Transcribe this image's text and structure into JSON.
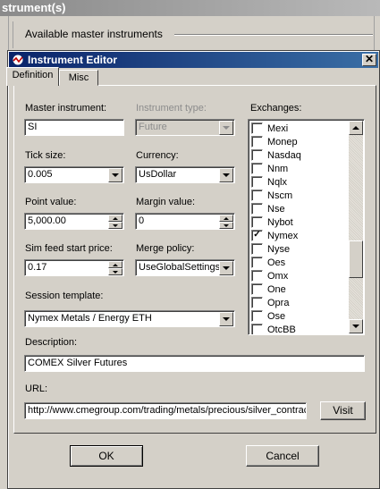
{
  "background_window": {
    "title": "strument(s)",
    "available_label": "Available master instruments"
  },
  "dialog": {
    "title": "Instrument Editor",
    "close_glyph": "✕",
    "tabs": [
      {
        "label": "Definition",
        "active": true
      },
      {
        "label": "Misc",
        "active": false
      }
    ]
  },
  "form": {
    "master_instrument": {
      "label": "Master instrument:",
      "value": "SI"
    },
    "instrument_type": {
      "label": "Instrument type:",
      "value": "Future",
      "enabled": false
    },
    "tick_size": {
      "label": "Tick size:",
      "value": "0.005"
    },
    "currency": {
      "label": "Currency:",
      "value": "UsDollar"
    },
    "point_value": {
      "label": "Point value:",
      "value": "5,000.00"
    },
    "margin_value": {
      "label": "Margin value:",
      "value": "0"
    },
    "sim_feed_start_price": {
      "label": "Sim feed start price:",
      "value": "0.17"
    },
    "merge_policy": {
      "label": "Merge policy:",
      "value": "UseGlobalSettings"
    },
    "session_template": {
      "label": "Session template:",
      "value": "Nymex Metals / Energy ETH"
    },
    "description": {
      "label": "Description:",
      "value": "COMEX Silver Futures"
    },
    "url": {
      "label": "URL:",
      "value": "http://www.cmegroup.com/trading/metals/precious/silver_contract"
    }
  },
  "exchanges": {
    "label": "Exchanges:",
    "items": [
      {
        "name": "Mexi",
        "checked": false
      },
      {
        "name": "Monep",
        "checked": false
      },
      {
        "name": "Nasdaq",
        "checked": false
      },
      {
        "name": "Nnm",
        "checked": false
      },
      {
        "name": "Nqlx",
        "checked": false
      },
      {
        "name": "Nscm",
        "checked": false
      },
      {
        "name": "Nse",
        "checked": false
      },
      {
        "name": "Nybot",
        "checked": false
      },
      {
        "name": "Nymex",
        "checked": true
      },
      {
        "name": "Nyse",
        "checked": false
      },
      {
        "name": "Oes",
        "checked": false
      },
      {
        "name": "Omx",
        "checked": false
      },
      {
        "name": "One",
        "checked": false
      },
      {
        "name": "Opra",
        "checked": false
      },
      {
        "name": "Ose",
        "checked": false
      },
      {
        "name": "OtcBB",
        "checked": false
      }
    ],
    "check_glyph": "✓"
  },
  "buttons": {
    "visit": "Visit",
    "ok": "OK",
    "cancel": "Cancel"
  },
  "colors": {
    "title_active_start": "#0a246a",
    "title_active_end": "#3a6ea5",
    "face": "#d4d0c8"
  }
}
